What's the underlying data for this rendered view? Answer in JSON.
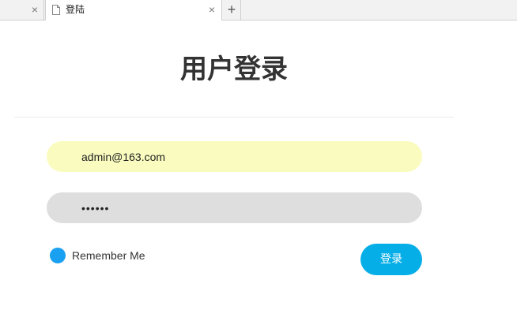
{
  "browser": {
    "tabs": [
      {
        "title": "",
        "close_glyph": "×"
      },
      {
        "title": "登陆",
        "close_glyph": "×",
        "active": true
      }
    ],
    "new_tab_glyph": "+"
  },
  "page": {
    "title": "用户登录"
  },
  "form": {
    "email_value": "admin@163.com",
    "password_value": "••••••",
    "remember_label": "Remember Me",
    "remember_checked": true,
    "submit_label": "登录"
  },
  "colors": {
    "email_bg": "#fafcbf",
    "password_bg": "#dedede",
    "remember_dot": "#1aa0f0",
    "submit_bg": "#06aee8"
  },
  "icons": {
    "tab_page": "page-icon",
    "tab_close": "close-icon",
    "new_tab": "plus-icon",
    "remember": "radio-dot-icon"
  }
}
